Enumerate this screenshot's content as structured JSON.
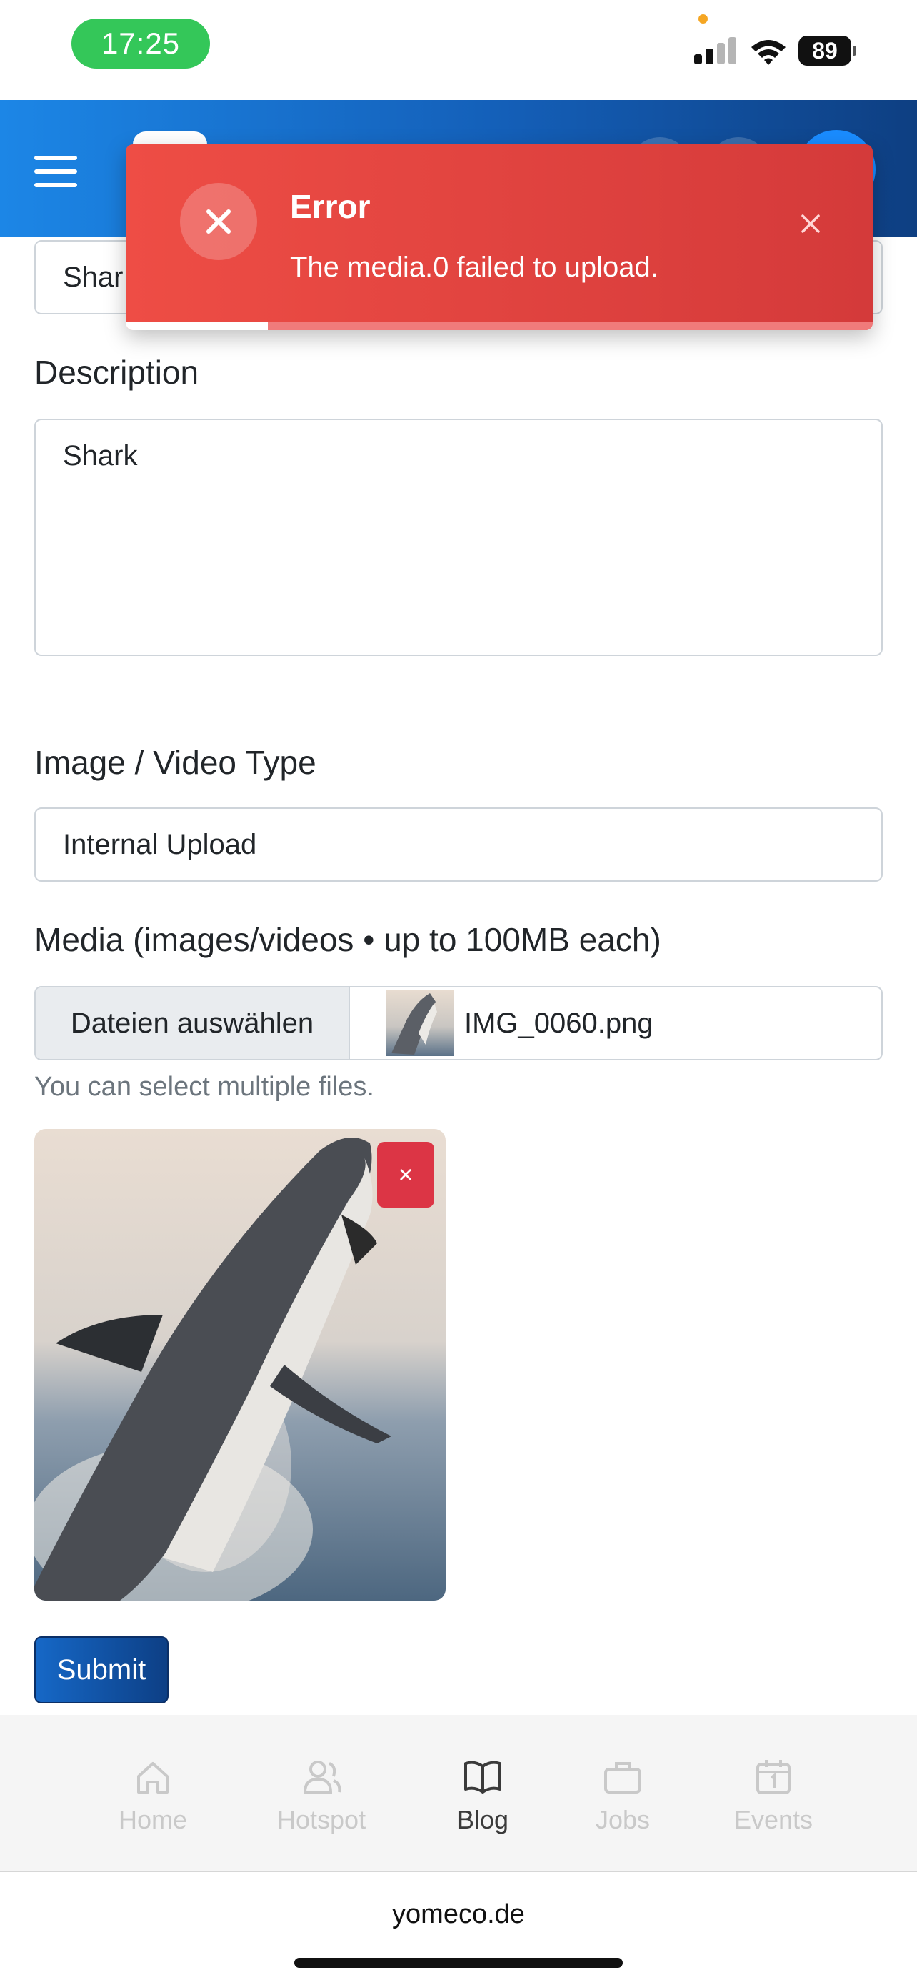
{
  "status_bar": {
    "time": "17:25",
    "battery": "89",
    "icons": [
      "signal-icon",
      "wifi-icon",
      "battery-icon"
    ]
  },
  "header": {
    "icons": [
      "menu-icon",
      "logo",
      "avatar"
    ]
  },
  "form": {
    "title_value": "Shar",
    "description_label": "Description",
    "description_value": "Shark",
    "media_type_label": "Image / Video Type",
    "media_type_value": "Internal Upload",
    "media_label": "Media (images/videos • up to 100MB each)",
    "file_button_label": "Dateien auswählen",
    "file_name": "IMG_0060.png",
    "help_text": "You can select multiple files.",
    "remove_label": "×",
    "submit_label": "Submit"
  },
  "toast": {
    "title": "Error",
    "message": "The media.0 failed to upload.",
    "progress_fraction": 0.19,
    "colors": {
      "background": "#e0443f",
      "progress": "#ffffff"
    }
  },
  "bottom_nav": {
    "items": [
      {
        "label": "Home",
        "icon": "home-icon",
        "active": false
      },
      {
        "label": "Hotspot",
        "icon": "users-icon",
        "active": false
      },
      {
        "label": "Blog",
        "icon": "book-icon",
        "active": true
      },
      {
        "label": "Jobs",
        "icon": "briefcase-icon",
        "active": false
      },
      {
        "label": "Events",
        "icon": "calendar-icon",
        "active": false
      }
    ]
  },
  "browser": {
    "url": "yomeco.de"
  }
}
